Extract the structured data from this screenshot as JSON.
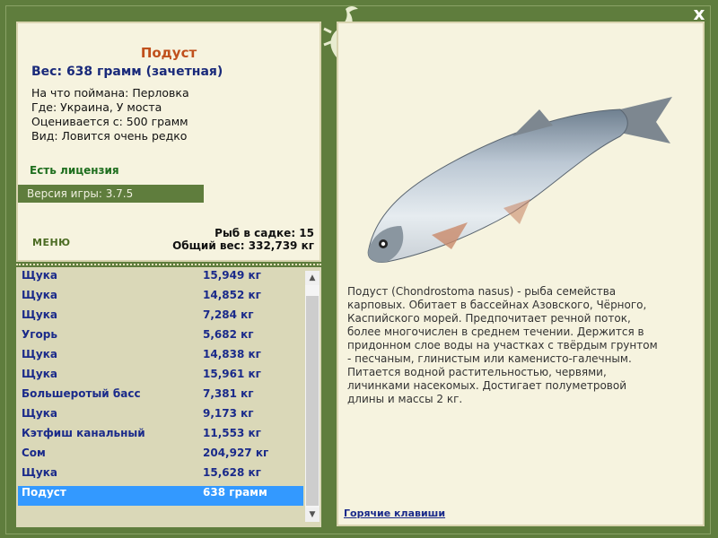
{
  "fish": {
    "title": "Подуст",
    "weight_line": "Вес: 638 грамм (зачетная)",
    "caught_on": "На что поймана: Перловка",
    "where": "Где: Украина, У моста",
    "valued_from": "Оценивается с: 500 грамм",
    "kind": "Вид: Ловится очень редко",
    "description": "Подуст (Chondrostoma nasus) - рыба семейства карповых. Обитает в бассейнах Азовского, Чёрного, Каспийского морей. Предпочитает речной поток, более многочислен в среднем течении. Держится в придонном слое воды на участках с твёрдым грунтом - песчаным, глинистым или каменисто-галечным. Питается водной растительностью, червями, личинками насекомых. Достигает полуметровой длины и массы 2 кг."
  },
  "license": "Есть лицензия",
  "version": "Версия игры: 3.7.5",
  "menu_label": "МЕНЮ",
  "cage": {
    "count": "Рыб в садке: 15",
    "total": "Общий вес: 332,739 кг"
  },
  "catch_list": [
    {
      "name": "Щука",
      "weight": "15,949 кг"
    },
    {
      "name": "Щука",
      "weight": "14,852 кг"
    },
    {
      "name": "Щука",
      "weight": "7,284 кг"
    },
    {
      "name": "Угорь",
      "weight": "5,682 кг"
    },
    {
      "name": "Щука",
      "weight": "14,838 кг"
    },
    {
      "name": "Щука",
      "weight": "15,961 кг"
    },
    {
      "name": "Большеротый басс",
      "weight": "7,381 кг"
    },
    {
      "name": "Щука",
      "weight": "9,173 кг"
    },
    {
      "name": "Кэтфиш канальный",
      "weight": "11,553 кг"
    },
    {
      "name": "Сом",
      "weight": "204,927 кг"
    },
    {
      "name": "Щука",
      "weight": "15,628 кг"
    },
    {
      "name": "Подуст",
      "weight": "638 грамм",
      "selected": true
    }
  ],
  "hotkeys_label": "Горячие клавиши",
  "close_label": "x",
  "icons": {
    "close": "close-icon",
    "logo": "lizard-logo-icon",
    "scroll_up": "arrow-up-icon",
    "scroll_down": "arrow-down-icon"
  },
  "colors": {
    "frame": "#5f7d3d",
    "panel": "#f6f3df",
    "title": "#c0501c",
    "selected": "#3399ff"
  }
}
